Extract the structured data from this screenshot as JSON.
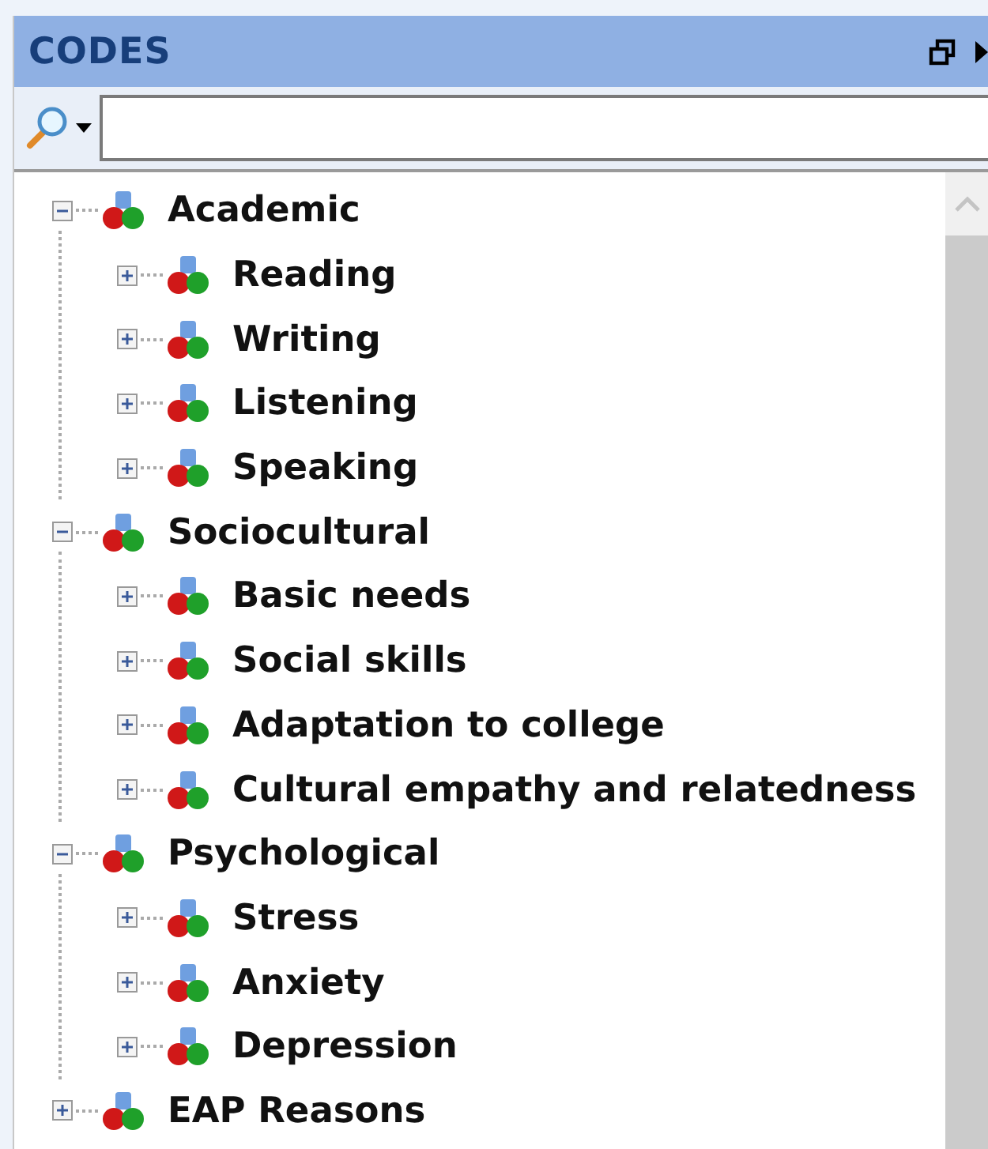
{
  "panel": {
    "title": "CODES"
  },
  "tree": [
    {
      "label": "Academic",
      "expanded": true,
      "children": [
        {
          "label": "Reading",
          "expanded": false
        },
        {
          "label": "Writing",
          "expanded": false
        },
        {
          "label": "Listening",
          "expanded": false
        },
        {
          "label": "Speaking",
          "expanded": false
        }
      ]
    },
    {
      "label": "Sociocultural",
      "expanded": true,
      "children": [
        {
          "label": "Basic needs",
          "expanded": false
        },
        {
          "label": "Social skills",
          "expanded": false
        },
        {
          "label": "Adaptation to college",
          "expanded": false
        },
        {
          "label": "Cultural empathy and relatedness",
          "expanded": false
        }
      ]
    },
    {
      "label": "Psychological",
      "expanded": true,
      "children": [
        {
          "label": "Stress",
          "expanded": false
        },
        {
          "label": "Anxiety",
          "expanded": false
        },
        {
          "label": "Depression",
          "expanded": false
        }
      ]
    },
    {
      "label": "EAP Reasons",
      "expanded": false
    }
  ]
}
